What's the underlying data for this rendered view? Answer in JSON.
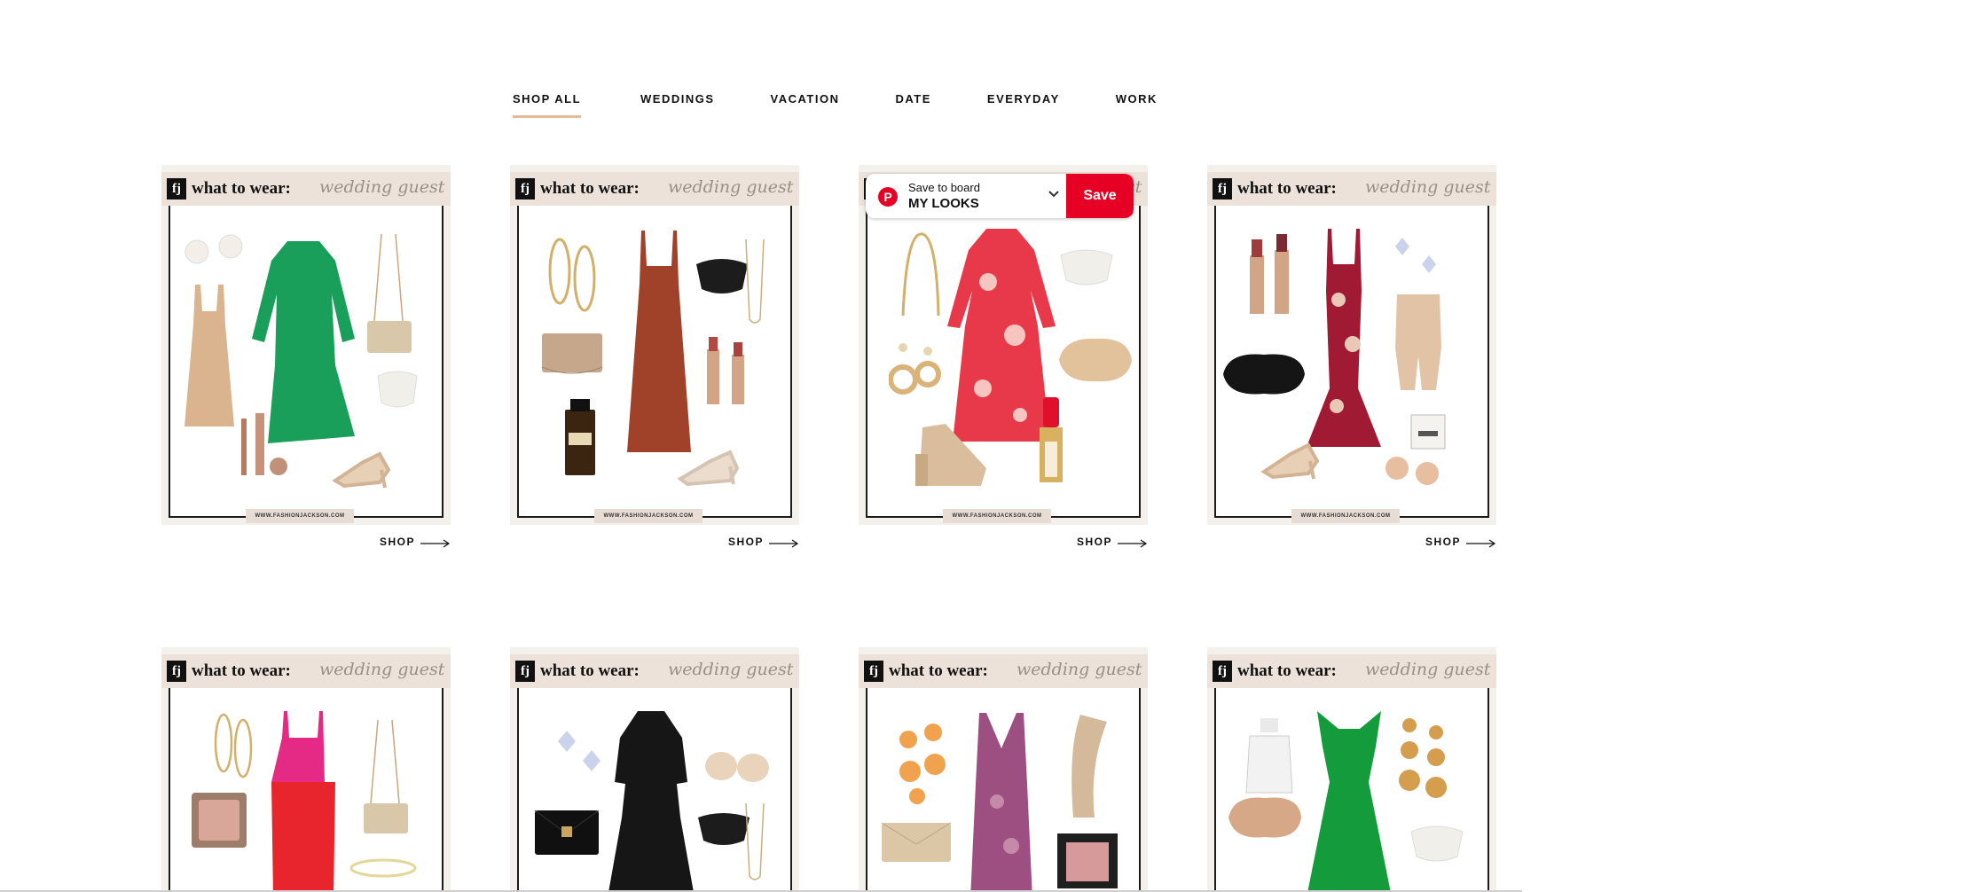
{
  "tabs": [
    {
      "label": "SHOP ALL",
      "active": true
    },
    {
      "label": "WEDDINGS",
      "active": false
    },
    {
      "label": "VACATION",
      "active": false
    },
    {
      "label": "DATE",
      "active": false
    },
    {
      "label": "EVERYDAY",
      "active": false
    },
    {
      "label": "WORK",
      "active": false
    }
  ],
  "card": {
    "brand_mark": "fj",
    "heading": "what to wear:",
    "script_heading": "wedding guest",
    "url": "WWW.FASHIONJACKSON.COM",
    "shop_label": "SHOP"
  },
  "pinterest": {
    "save_to_board": "Save to board",
    "board_name": "MY LOOKS",
    "save_button": "Save"
  },
  "colors": {
    "accent_underline": "#e4b99c",
    "pinterest_red": "#e60023",
    "header_band": "#ece2da"
  },
  "icons": {
    "shop_arrow": "arrow-right-icon",
    "pinterest": "pinterest-icon",
    "board_dropdown": "chevron-down-icon"
  }
}
